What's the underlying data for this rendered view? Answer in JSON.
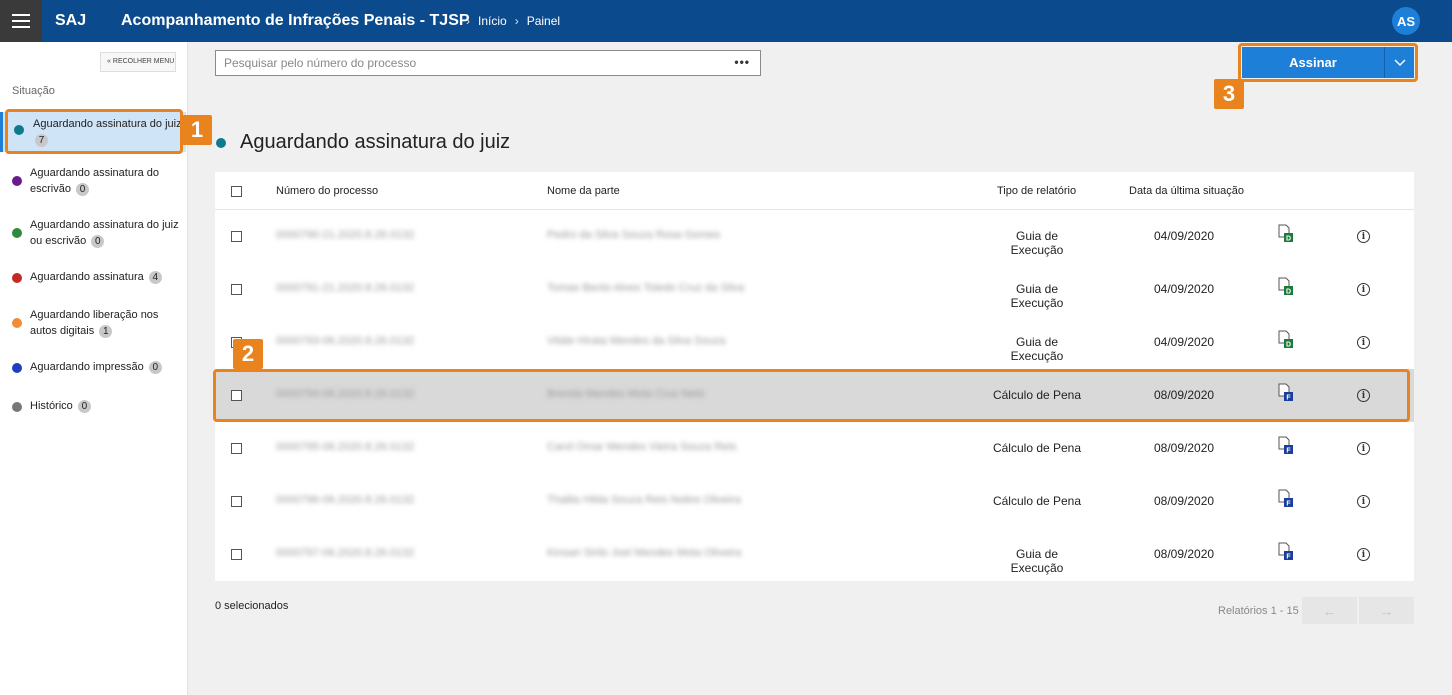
{
  "topbar": {
    "brand": "SAJ",
    "title": "Acompanhamento de Infrações Penais - TJSP",
    "breadcrumb": [
      "Início",
      "Painel"
    ],
    "avatar": "AS"
  },
  "sidebar": {
    "collapse_label": "RECOLHER MENU",
    "section_label": "Situação",
    "items": [
      {
        "label": "Aguardando assinatura do juiz",
        "count": "7",
        "color": "#0e7b8b"
      },
      {
        "label": "Aguardando assinatura do escrivão",
        "count": "0",
        "color": "#6a1b8a"
      },
      {
        "label": "Aguardando assinatura do juiz ou escrivão",
        "count": "0",
        "color": "#2e8b3e"
      },
      {
        "label": "Aguardando assinatura",
        "count": "4",
        "color": "#c62828"
      },
      {
        "label": "Aguardando liberação nos autos digitais",
        "count": "1",
        "color": "#f28c38"
      },
      {
        "label": "Aguardando impressão",
        "count": "0",
        "color": "#1e3fbf"
      },
      {
        "label": "Histórico",
        "count": "0",
        "color": "#777777"
      }
    ]
  },
  "search": {
    "placeholder": "Pesquisar pelo número do processo",
    "more": "•••"
  },
  "sign_button": {
    "label": "Assinar",
    "chevron": "⌵"
  },
  "heading": "Aguardando assinatura do juiz",
  "table": {
    "headers": [
      "Número do processo",
      "Nome da parte",
      "Tipo de relatório",
      "Data da última situação"
    ],
    "rows": [
      {
        "process": "0000790-21.2020.8.26.0132",
        "party": "Pedro da Silva Souza Rosa Gomes",
        "type": "Guia de Execução",
        "date": "04/09/2020",
        "doc": "D"
      },
      {
        "process": "0000791-21.2020.8.26.0132",
        "party": "Tomas Bento Alves Toledo Cruz da Silva",
        "type": "Guia de Execução",
        "date": "04/09/2020",
        "doc": "D"
      },
      {
        "process": "0000793-06.2020.8.26.0132",
        "party": "Vitále Hirata Mendes da Silva Souza",
        "type": "Guia de Execução",
        "date": "04/09/2020",
        "doc": "D"
      },
      {
        "process": "0000794-06.2020.8.26.0132",
        "party": "Brenda Mendes Mota Cruz Neto",
        "type": "Cálculo de Pena",
        "date": "08/09/2020",
        "doc": "F"
      },
      {
        "process": "0000795-06.2020.8.26.0132",
        "party": "Carol Omar Mendes Vieira Souza Reis",
        "type": "Cálculo de Pena",
        "date": "08/09/2020",
        "doc": "F"
      },
      {
        "process": "0000796-06.2020.8.26.0132",
        "party": "Thalita Hilda Souza Reis Nobre Oliveira",
        "type": "Cálculo de Pena",
        "date": "08/09/2020",
        "doc": "F"
      },
      {
        "process": "0000797-06.2020.8.26.0132",
        "party": "Kinsari Sirilo Joel Mendes Mota Oliveira",
        "type": "Guia de Execução",
        "date": "08/09/2020",
        "doc": "F"
      }
    ]
  },
  "footer": {
    "selected": "0 selecionados",
    "pager": "Relatórios 1 - 15",
    "prev": "←",
    "next": "→"
  },
  "annotations": [
    "1",
    "2",
    "3"
  ],
  "colors": {
    "topbar": "#0b4a8c",
    "accent": "#1e7fd8",
    "highlight": "#e8831e"
  }
}
